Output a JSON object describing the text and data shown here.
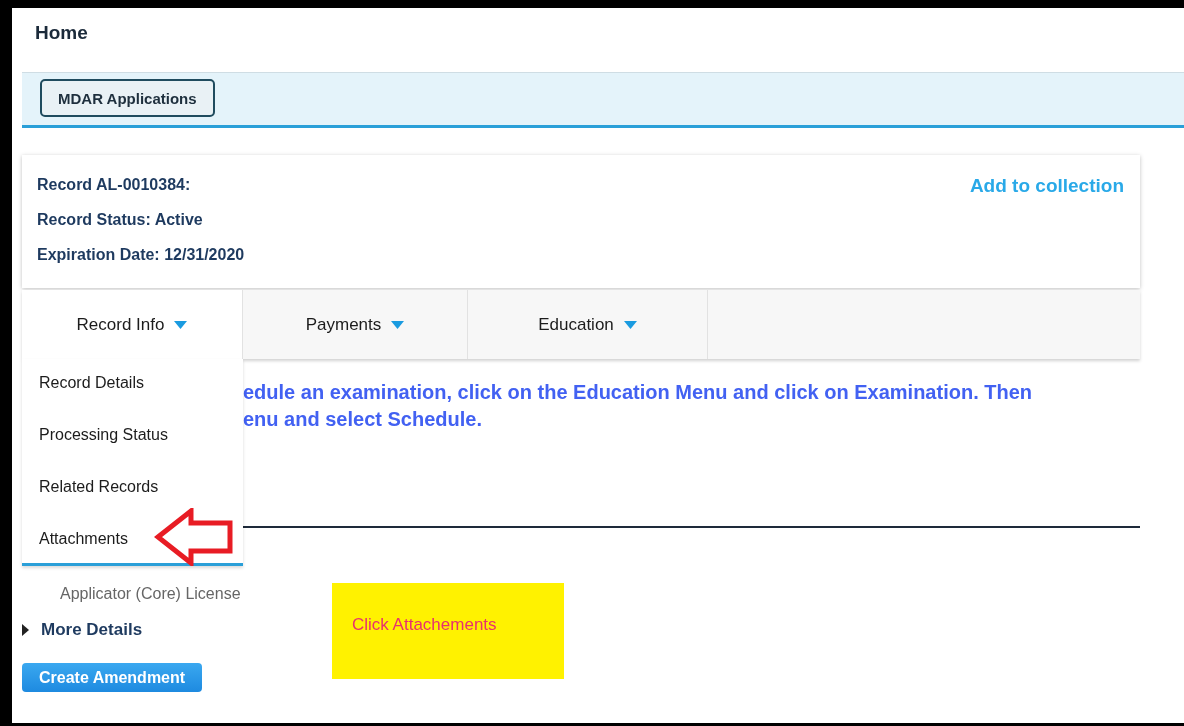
{
  "page": {
    "title": "Home"
  },
  "toolbar": {
    "buttons": [
      {
        "label": "MDAR Applications"
      }
    ]
  },
  "record": {
    "lines": [
      "Record AL-0010384:",
      "Record Status: Active",
      "Expiration Date: 12/31/2020"
    ],
    "link": "Add to collection"
  },
  "tabs": [
    {
      "label": "Record Info",
      "expanded": true
    },
    {
      "label": "Payments",
      "expanded": false
    },
    {
      "label": "Education",
      "expanded": false
    }
  ],
  "dropdown": {
    "items": [
      "Record Details",
      "Processing Status",
      "Related Records",
      "Attachments"
    ]
  },
  "notice": {
    "lines": [
      "edule an examination, click on the Education Menu and click on Examination. Then",
      "enu and select Schedule."
    ]
  },
  "details": {
    "license": "Applicator (Core) License",
    "more_details": {
      "label": "More Details",
      "expanded": false
    },
    "button": "Create Amendment"
  },
  "annotation": {
    "text": "Click Attachements"
  }
}
